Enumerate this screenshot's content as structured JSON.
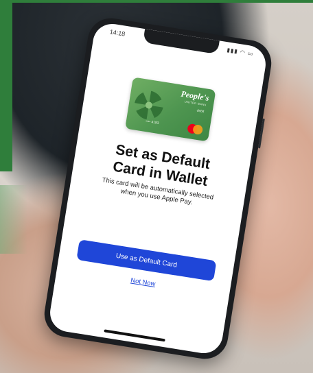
{
  "status": {
    "time": "14:18",
    "icons": "▮▮▮ ◠ ▭"
  },
  "card": {
    "brand": "People's",
    "sub": "UNITED BANK",
    "type": "debit",
    "number": "•••• 4183"
  },
  "dialog": {
    "title_line1": "Set as Default",
    "title_line2": "Card in Wallet",
    "subtitle_line1": "This card will be automatically selected",
    "subtitle_line2": "when you use Apple Pay.",
    "primary_button": "Use as Default Card",
    "secondary_link": "Not Now"
  },
  "colors": {
    "accent": "#1f46d8",
    "card_green": "#4e9550",
    "frame_green": "#2f7e3b"
  }
}
